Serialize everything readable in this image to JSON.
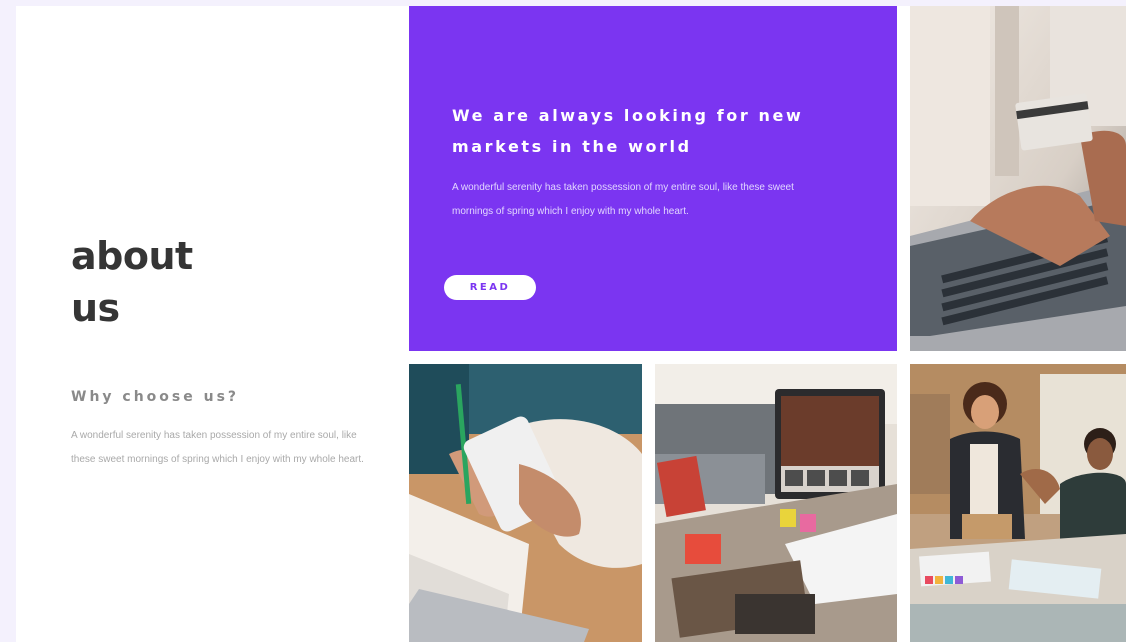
{
  "about": {
    "title_line1": "about",
    "title_line2": "us",
    "subtitle": "Why choose us?",
    "text": "A wonderful serenity has taken possession of my entire soul, like these sweet mornings of spring which I enjoy with my whole heart."
  },
  "feature": {
    "heading_line1": "We are always looking for new",
    "heading_line2": "markets in the world",
    "text": "A wonderful serenity has taken possession of my entire soul, like these sweet mornings of spring which I enjoy with my whole heart.",
    "button_label": "READ",
    "background_color": "#7b35f1"
  }
}
